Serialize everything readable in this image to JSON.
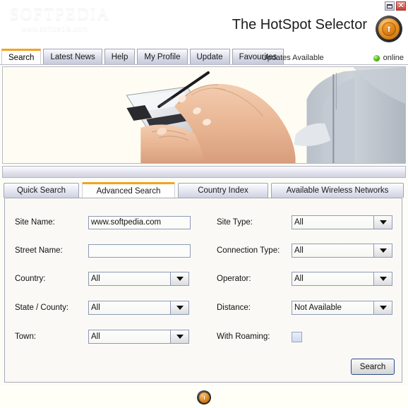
{
  "window": {
    "restore_label": "restore",
    "close_label": "✕"
  },
  "watermark": {
    "main": "SOFTPEDIA",
    "sub": "www.softpedia.com"
  },
  "header": {
    "title": "The HotSpot Selector",
    "logo_icon": "hotspot-logo-icon"
  },
  "tabs": [
    {
      "label": "Search",
      "active": true
    },
    {
      "label": "Latest News",
      "active": false
    },
    {
      "label": "Help",
      "active": false
    },
    {
      "label": "My Profile",
      "active": false
    },
    {
      "label": "Update",
      "active": false
    },
    {
      "label": "Favourites",
      "active": false
    }
  ],
  "status": {
    "updates": "Updates Available",
    "connection": "online",
    "online_color": "#57c41e"
  },
  "banner": {
    "alt": "Hands holding a PDA with stylus"
  },
  "subtabs": [
    {
      "label": "Quick Search",
      "active": false
    },
    {
      "label": "Advanced Search",
      "active": true
    },
    {
      "label": "Country Index",
      "active": false
    },
    {
      "label": "Available Wireless Networks",
      "active": false
    }
  ],
  "form": {
    "left": [
      {
        "label": "Site Name:",
        "type": "text",
        "value": "www.softpedia.com",
        "placeholder": ""
      },
      {
        "label": "Street Name:",
        "type": "text",
        "value": "",
        "placeholder": ""
      },
      {
        "label": "Country:",
        "type": "combo",
        "value": "All"
      },
      {
        "label": "State / County:",
        "type": "combo",
        "value": "All"
      },
      {
        "label": "Town:",
        "type": "combo",
        "value": "All"
      }
    ],
    "right": [
      {
        "label": "Site Type:",
        "type": "combo",
        "value": "All"
      },
      {
        "label": "Connection Type:",
        "type": "combo",
        "value": "All"
      },
      {
        "label": "Operator:",
        "type": "combo",
        "value": "All"
      },
      {
        "label": "Distance:",
        "type": "combo",
        "value": "Not Available"
      },
      {
        "label": "With Roaming:",
        "type": "checkbox",
        "checked": false
      }
    ],
    "search_button": "Search"
  },
  "statusbar": {
    "logo_icon": "hotspot-logo-icon"
  },
  "theme": {
    "accent_orange": "#f2a31c",
    "tab_border": "#9fa3b4",
    "panel_bg": "#faf9f6",
    "button_border": "#2b4c86"
  }
}
